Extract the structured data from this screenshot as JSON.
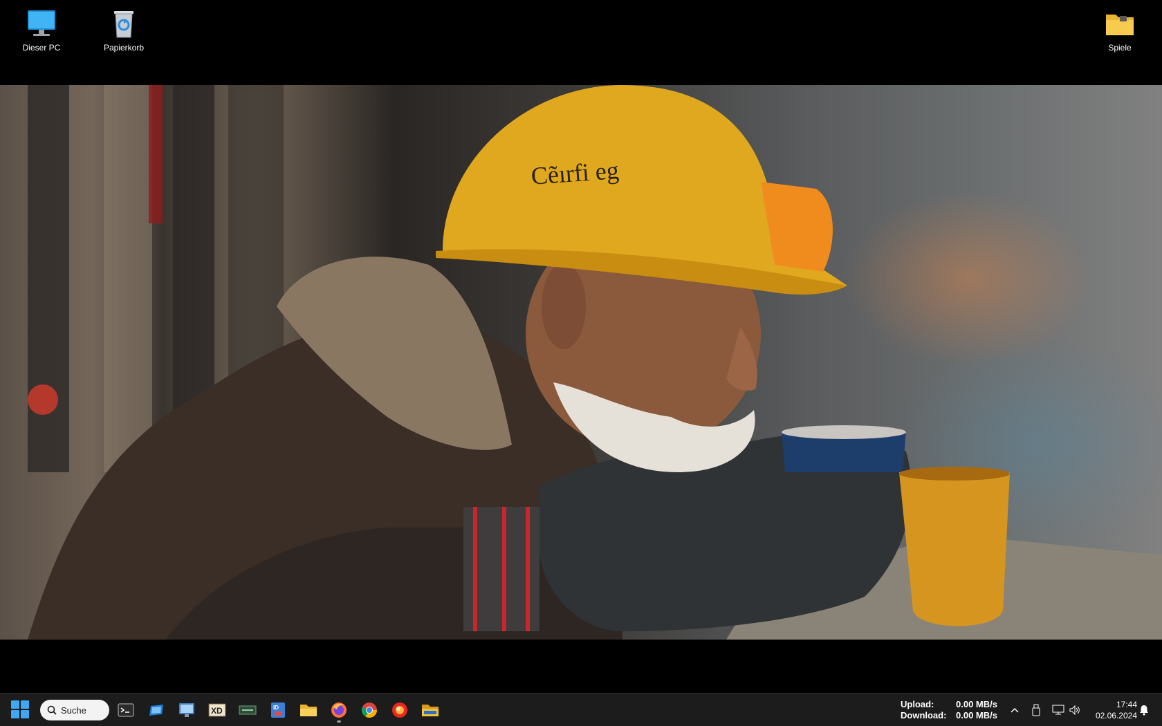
{
  "desktop": {
    "icons": [
      {
        "name": "this-pc",
        "label": "Dieser PC"
      },
      {
        "name": "recycle-bin",
        "label": "Papierkorb"
      },
      {
        "name": "games-folder",
        "label": "Spiele"
      }
    ],
    "wallpaper": {
      "helmet_text": "Cẽırfi eg"
    }
  },
  "taskbar": {
    "search_label": "Suche",
    "apps": [
      {
        "name": "terminal-icon"
      },
      {
        "name": "app-blue-window-icon"
      },
      {
        "name": "app-monitor-icon"
      },
      {
        "name": "app-xd-icon"
      },
      {
        "name": "app-gpu-icon"
      },
      {
        "name": "app-id-badge-icon"
      },
      {
        "name": "file-explorer-icon"
      },
      {
        "name": "firefox-icon"
      },
      {
        "name": "chrome-icon"
      },
      {
        "name": "app-red-circle-icon"
      },
      {
        "name": "folder-icon"
      }
    ],
    "net": {
      "upload_label": "Upload:",
      "upload_value": "0.00 MB/s",
      "download_label": "Download:",
      "download_value": "0.00 MB/s"
    },
    "clock": {
      "time": "17:44",
      "date": "02.06.2024"
    }
  },
  "colors": {
    "taskbar_bg": "#1c1c1c",
    "start_blue": "#3ea8f5",
    "helmet_yellow": "#e0a81e"
  }
}
